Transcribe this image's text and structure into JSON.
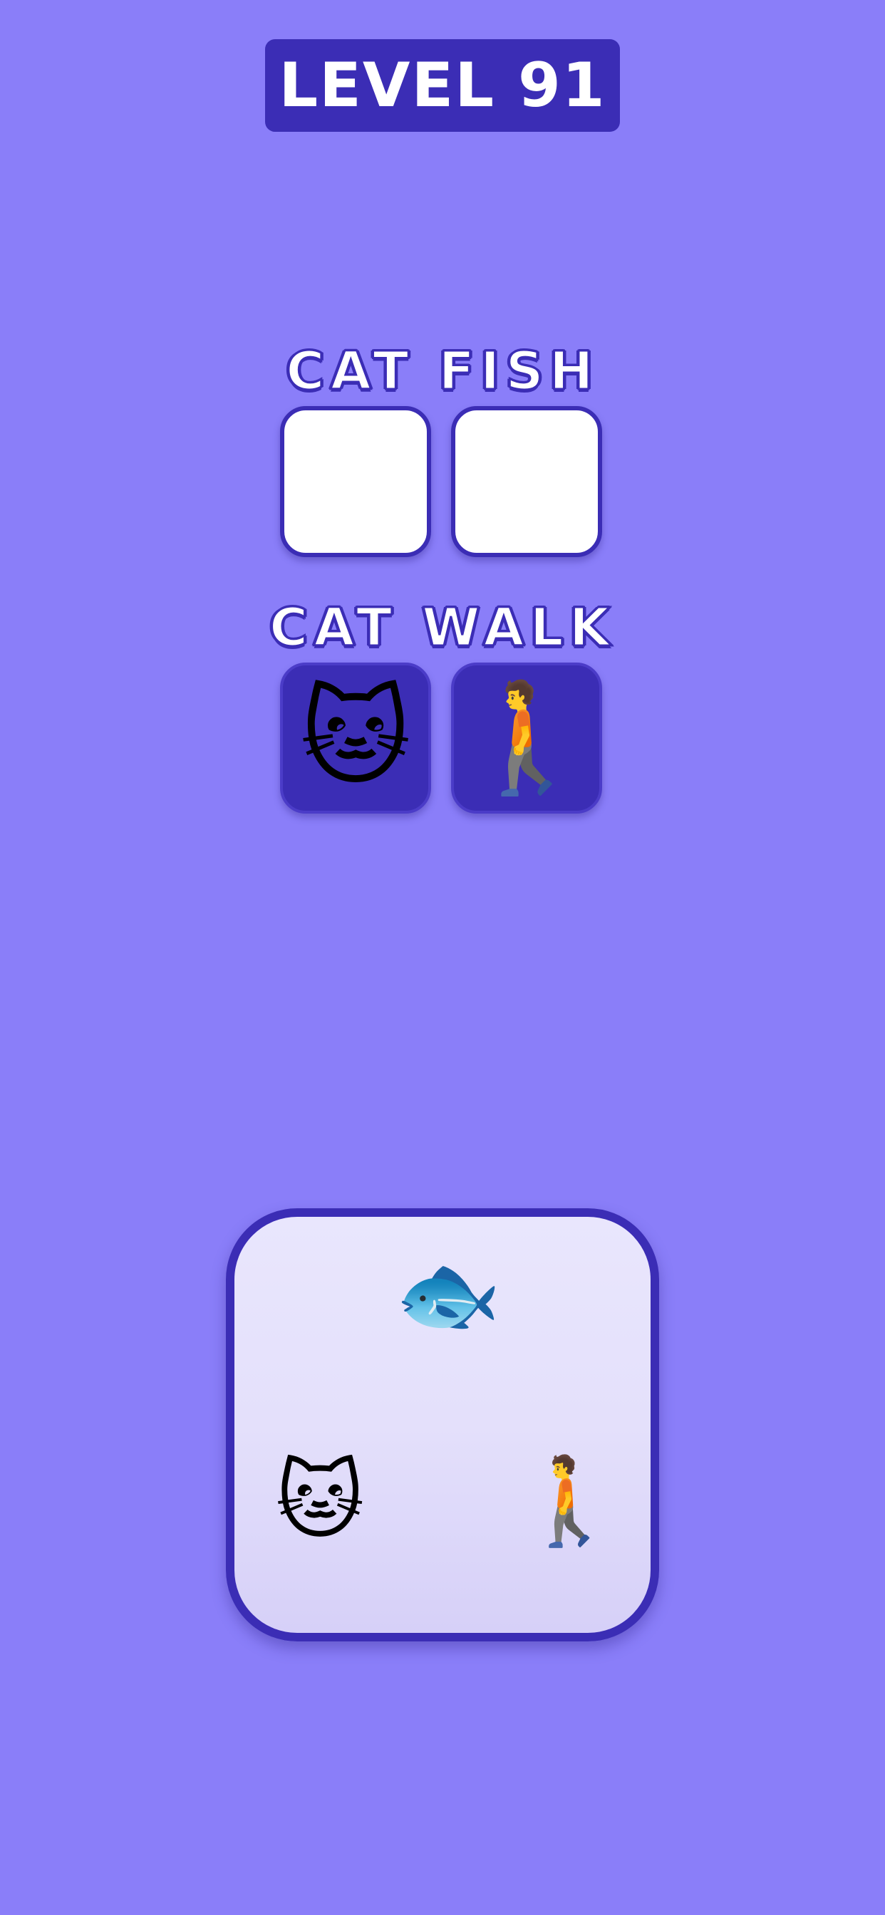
{
  "level": {
    "label": "LEVEL 91"
  },
  "puzzles": [
    {
      "word": "CAT FISH",
      "slots": [
        "",
        ""
      ]
    },
    {
      "word": "CAT WALK",
      "slots": [
        "🐱",
        "🚶"
      ]
    }
  ],
  "board": {
    "items": [
      {
        "name": "fish",
        "emoji": "🐟"
      },
      {
        "name": "cat",
        "emoji": "🐱"
      },
      {
        "name": "person-walking",
        "emoji": "🚶"
      }
    ]
  },
  "colors": {
    "background": "#8a7ef9",
    "accent": "#3b2db5",
    "slot_empty": "#ffffff"
  }
}
